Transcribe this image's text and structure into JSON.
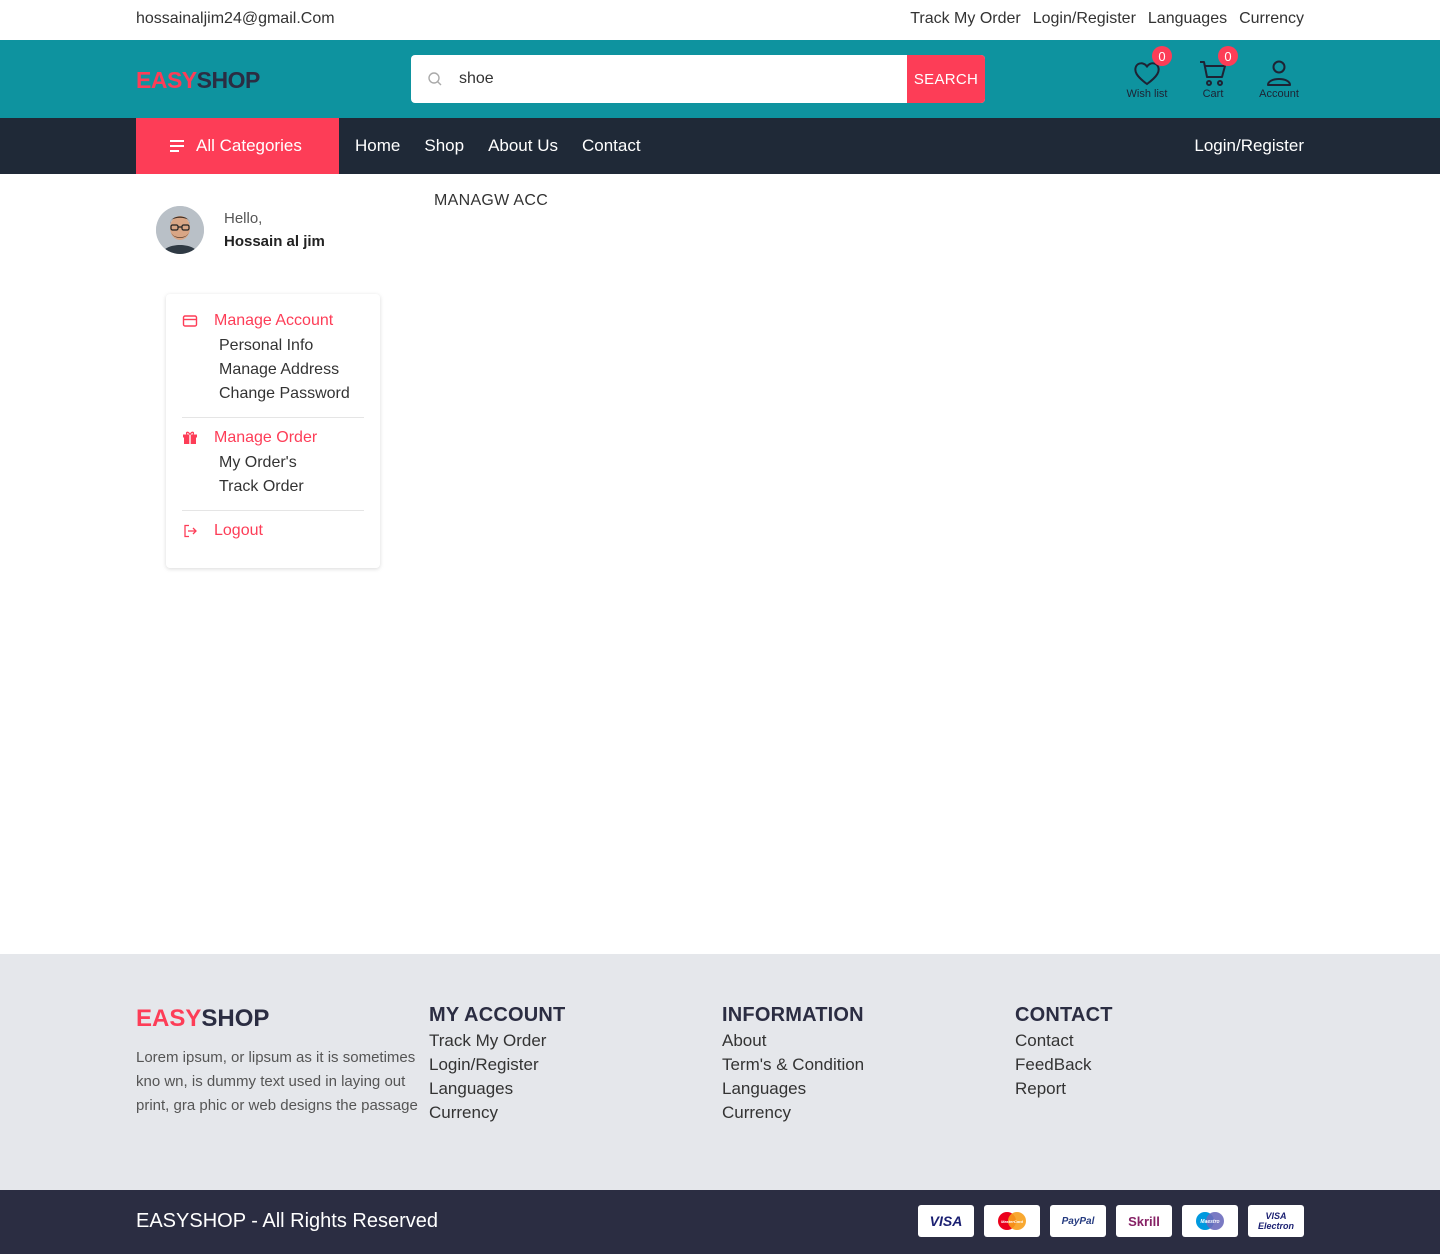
{
  "topbar": {
    "email": "hossainaljim24@gmail.Com",
    "links": [
      "Track My Order",
      "Login/Register",
      "Languages",
      "Currency"
    ]
  },
  "header": {
    "logo_part1": "EASY",
    "logo_part2": "SHOP",
    "search_value": "shoe",
    "search_button": "SEARCH",
    "wishlist_label": "Wish list",
    "wishlist_count": "0",
    "cart_label": "Cart",
    "cart_count": "0",
    "account_label": "Account",
    "accent_color": "#fd3d57",
    "header_color": "#0e939f"
  },
  "nav": {
    "all_categories": "All Categories",
    "links": [
      "Home",
      "Shop",
      "About Us",
      "Contact"
    ],
    "login": "Login/Register"
  },
  "profile": {
    "greeting": "Hello,",
    "name": "Hossain al jim"
  },
  "sidebar": {
    "manage_account": "Manage Account",
    "account_items": [
      "Personal Info",
      "Manage Address",
      "Change Password"
    ],
    "manage_order": "Manage Order",
    "order_items": [
      "My Order's",
      "Track Order"
    ],
    "logout": "Logout"
  },
  "main": {
    "title": "MANAGW ACC"
  },
  "footer": {
    "logo_part1": "EASY",
    "logo_part2": "SHOP",
    "description": "Lorem ipsum, or lipsum as it is sometimes kno wn, is dummy text used in laying out print, gra phic or web designs the passage",
    "col1_title": "MY ACCOUNT",
    "col1_items": [
      "Track My Order",
      "Login/Register",
      "Languages",
      "Currency"
    ],
    "col2_title": "INFORMATION",
    "col2_items": [
      "About",
      "Term's & Condition",
      "Languages",
      "Currency"
    ],
    "col3_title": "CONTACT",
    "col3_items": [
      "Contact",
      "FeedBack",
      "Report"
    ],
    "copyright": "EASYSHOP - All Rights Reserved",
    "payments": [
      "VISA",
      "MasterCard",
      "PayPal",
      "Skrill",
      "Maestro",
      "VISA Electron"
    ]
  }
}
